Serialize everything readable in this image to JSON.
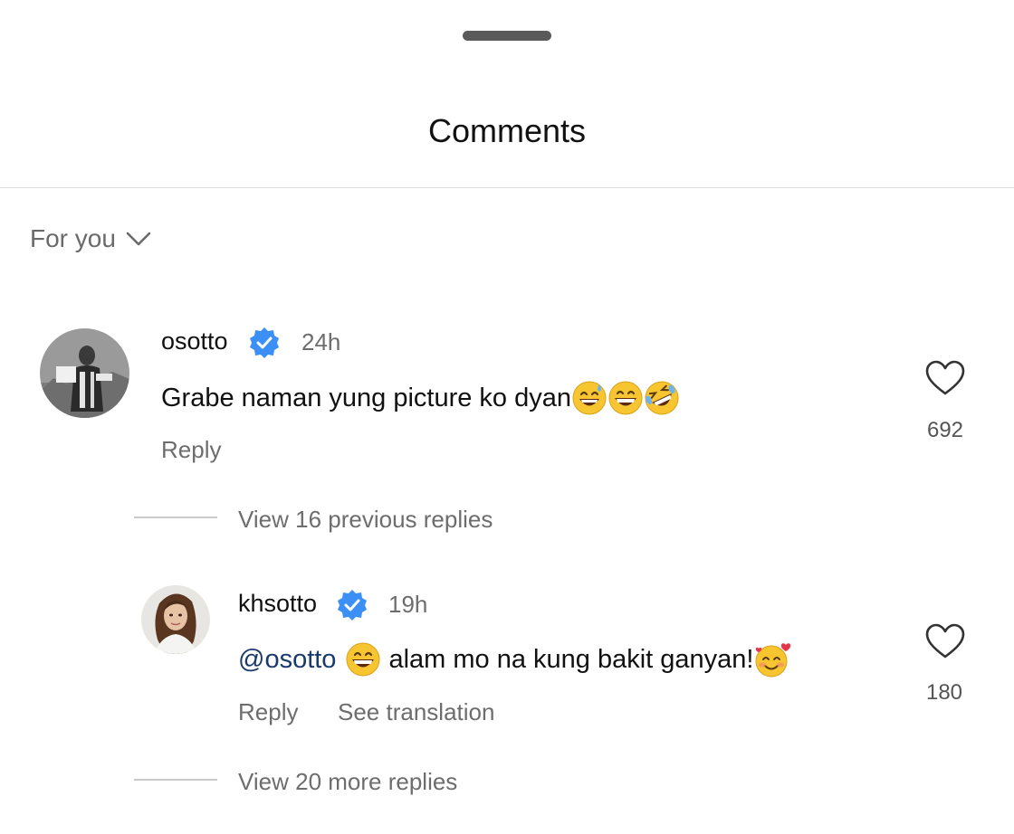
{
  "sheet": {
    "title": "Comments"
  },
  "sort": {
    "label": "For you"
  },
  "comments": [
    {
      "username": "osotto",
      "time": "24h",
      "text": "Grabe naman yung picture ko dyan",
      "emojis": [
        "grinning-sweat-emoji",
        "grinning-squint-emoji",
        "rolling-laughing-emoji"
      ],
      "reply_label": "Reply",
      "likes": "692"
    }
  ],
  "thread": {
    "view_previous": "View 16 previous replies"
  },
  "replies": [
    {
      "username": "khsotto",
      "time": "19h",
      "mention": "@osotto",
      "text": "alam mo na kung bakit ganyan!",
      "emojis": [
        "grinning-squint-emoji",
        "smiling-hearts-emoji"
      ],
      "reply_label": "Reply",
      "translate_label": "See translation",
      "likes": "180"
    }
  ],
  "thread_more": {
    "view_more": "View 20 more replies"
  },
  "colors": {
    "verified": "#3b8ff5",
    "mention": "#1a3a6b",
    "muted_text": "#6d6d6d"
  }
}
